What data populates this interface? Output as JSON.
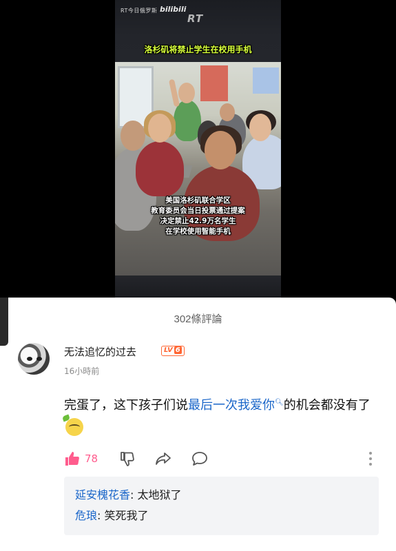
{
  "video": {
    "watermark_source": "RT今日俄罗斯",
    "watermark_platform": "bilibili",
    "watermark_channel": "RT",
    "title": "洛杉矶将禁止学生在校用手机",
    "caption_lines": [
      "美国洛杉矶联合学区",
      "教育委员会当日投票通过提案",
      "决定禁止42.9万名学生",
      "在学校使用智能手机"
    ]
  },
  "comments_panel": {
    "title": "302條評論",
    "comment": {
      "username": "无法追忆的过去",
      "level_label": "LV",
      "level_value": "6",
      "time": "16小時前",
      "text_part1": "完蛋了，这下孩子们说",
      "text_link": "最后一次我爱你",
      "text_part2": "的机会都没有了",
      "emoji": "lemon-face-emoji",
      "like_count": "78"
    },
    "replies": [
      {
        "author": "延安槐花香",
        "separator": ": ",
        "text": "太地狱了"
      },
      {
        "author": "危琅",
        "separator": ": ",
        "text": "笑死我了"
      }
    ]
  },
  "colors": {
    "link": "#1a66c9",
    "like": "#ff5c8d",
    "level_badge": "#ff6633",
    "title_banner": "#d7ff3a"
  },
  "icons": [
    "thumbs-up-icon",
    "thumbs-down-icon",
    "share-icon",
    "comment-icon",
    "more-vertical-icon",
    "search-icon"
  ]
}
